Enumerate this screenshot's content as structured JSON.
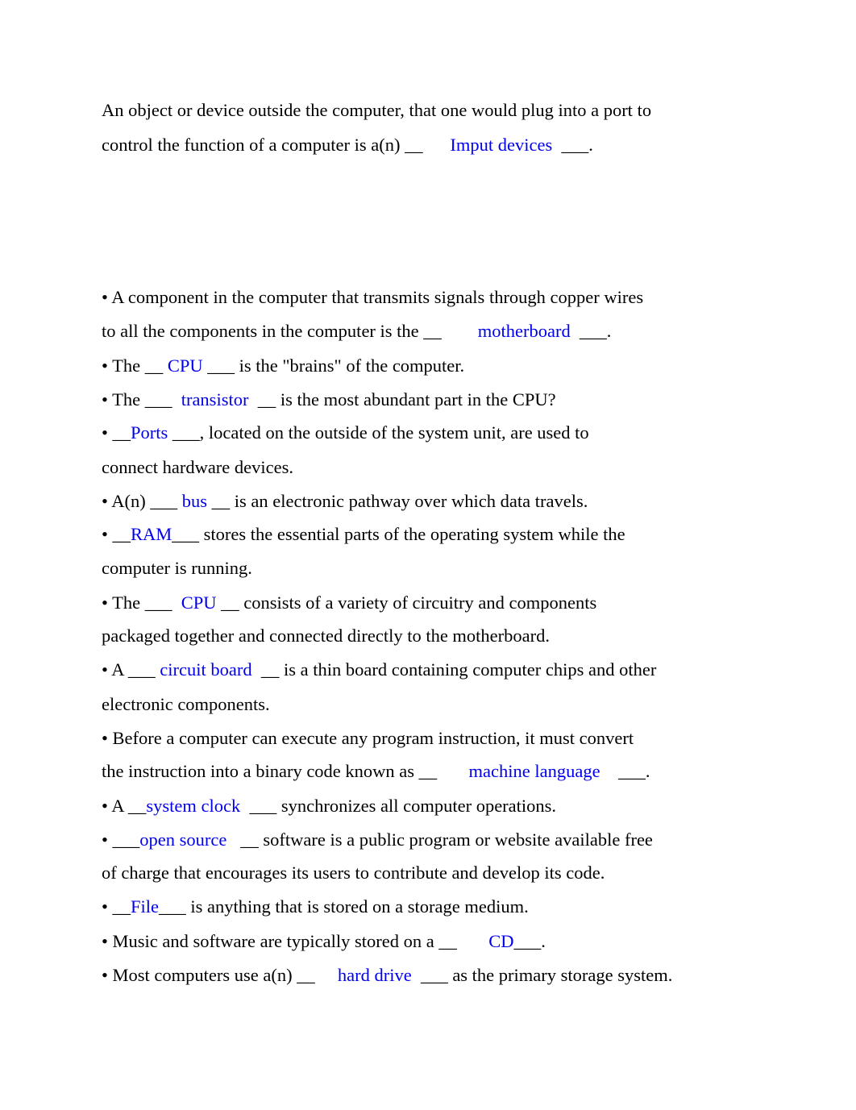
{
  "intro": {
    "line1": "An object or device outside the computer, that one would plug into a port to",
    "line2_pre": "control the function of a computer is a(n) __      ",
    "line2_ans": "Imput devices",
    "line2_post": "  ___."
  },
  "items": [
    {
      "pre": "• A component in the computer that transmits signals through copper wires",
      "ans": "",
      "post": ""
    },
    {
      "pre": "to all the components in the computer is the __        ",
      "ans": "motherboard",
      "post": "  ___."
    },
    {
      "pre": "• The __ ",
      "ans": "CPU",
      "post": " ___ is the \"brains\" of the computer."
    },
    {
      "pre": "• The ___  ",
      "ans": "transistor",
      "post": "  __ is the most abundant part in the CPU?"
    },
    {
      "pre": "• __",
      "ans": "Ports",
      "post": " ___, located on the outside of the system unit, are used to"
    },
    {
      "pre": "connect hardware devices.",
      "ans": "",
      "post": ""
    },
    {
      "pre": "• A(n) ___ ",
      "ans": "bus",
      "post": " __ is an electronic pathway over which data travels."
    },
    {
      "pre": "• __",
      "ans": "RAM",
      "post": "___ stores the essential parts of the operating system while the"
    },
    {
      "pre": "computer is running.",
      "ans": "",
      "post": ""
    },
    {
      "pre": "• The ___  ",
      "ans": "CPU",
      "post": " __ consists of a variety of circuitry and components"
    },
    {
      "pre": "packaged together and connected directly to the motherboard.",
      "ans": "",
      "post": ""
    },
    {
      "pre": "• A ___ ",
      "ans": "circuit board",
      "post": "  __ is a thin board containing computer chips and other"
    },
    {
      "pre": "electronic components.",
      "ans": "",
      "post": ""
    },
    {
      "pre": "• Before a computer can execute any program instruction, it must convert",
      "ans": "",
      "post": ""
    },
    {
      "pre": "the instruction into a binary code known as __       ",
      "ans": "machine language",
      "post": "    ___."
    },
    {
      "pre": "• A __",
      "ans": "system clock",
      "post": "  ___ synchronizes all computer operations."
    },
    {
      "pre": "• ___",
      "ans": "open source",
      "post": "   __ software is a public program or website available free"
    },
    {
      "pre": "of charge that encourages its users to contribute and develop its code.",
      "ans": "",
      "post": ""
    },
    {
      "pre": "• __",
      "ans": "File",
      "post": "___ is anything that is stored on a storage medium."
    },
    {
      "pre": "• Music and software are typically stored on a __       ",
      "ans": "CD",
      "post": "___."
    },
    {
      "pre": "• Most computers use a(n) __     ",
      "ans": "hard drive",
      "post": "  ___ as the primary storage system."
    }
  ],
  "colors": {
    "answer": "#0000ee",
    "text": "#000000"
  }
}
